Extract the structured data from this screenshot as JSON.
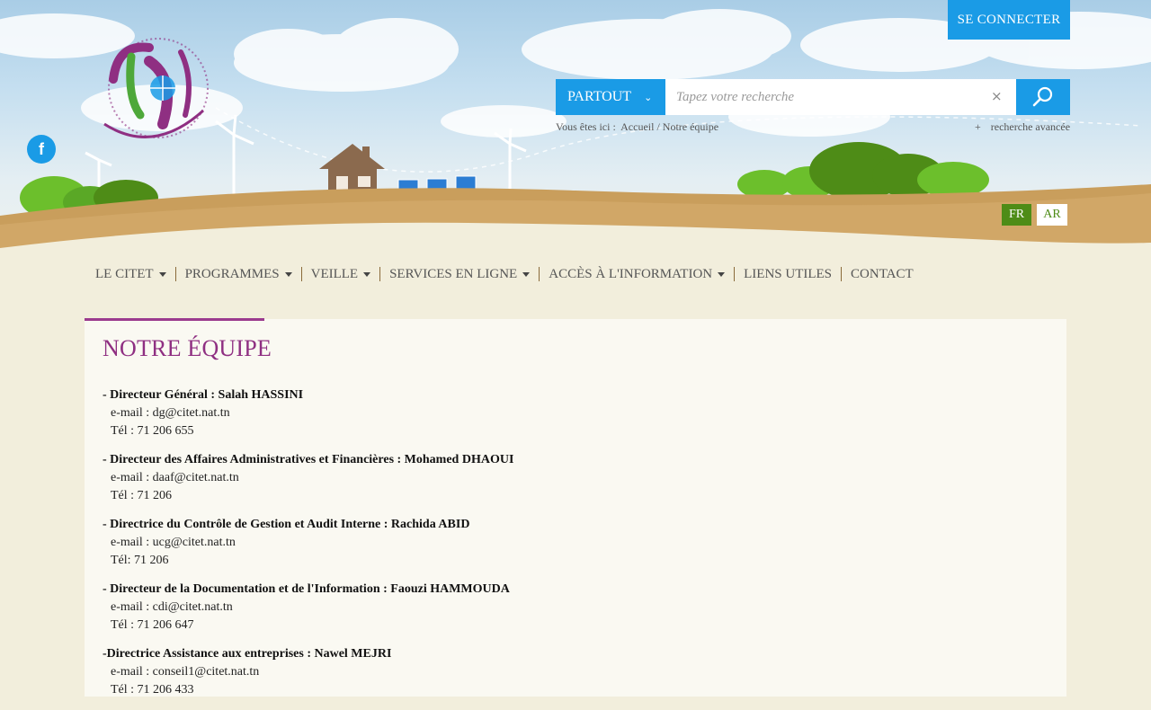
{
  "header": {
    "login_label": "SE CONNECTER",
    "facebook_icon": "f",
    "search": {
      "scope_label": "PARTOUT",
      "placeholder": "Tapez votre recherche",
      "clear_symbol": "×"
    },
    "breadcrumb": {
      "prefix": "Vous êtes ici :",
      "home": "Accueil",
      "separator": "/",
      "current": "Notre équipe"
    },
    "advanced_search": "recherche avancée",
    "advanced_plus": "+",
    "languages": [
      "FR",
      "AR"
    ],
    "colors": {
      "accent_blue": "#1a9be6",
      "green": "#4e8c17",
      "purple": "#8f2f82"
    }
  },
  "nav": {
    "items": [
      {
        "label": "LE CITET",
        "dropdown": true
      },
      {
        "label": "PROGRAMMES",
        "dropdown": true
      },
      {
        "label": "VEILLE",
        "dropdown": true
      },
      {
        "label": "SERVICES EN LIGNE",
        "dropdown": true
      },
      {
        "label": "ACCÈS À L'INFORMATION",
        "dropdown": true
      },
      {
        "label": "LIENS UTILES",
        "dropdown": false
      },
      {
        "label": "CONTACT",
        "dropdown": false
      }
    ]
  },
  "page": {
    "title": "NOTRE ÉQUIPE",
    "entries": [
      {
        "role": "- Directeur Général : Salah HASSINI",
        "email": "e-mail : dg@citet.nat.tn",
        "tel": "Tél : 71 206 655"
      },
      {
        "role": "- Directeur des Affaires Administratives et Financières : Mohamed DHAOUI",
        "email": "e-mail : daaf@citet.nat.tn",
        "tel": "Tél : 71 206"
      },
      {
        "role": "- Directrice du Contrôle de Gestion et Audit Interne : Rachida ABID",
        "email": "e-mail : ucg@citet.nat.tn",
        "tel": "Tél: 71 206"
      },
      {
        "role": "- Directeur de la Documentation et de l'Information : Faouzi HAMMOUDA",
        "email": "e-mail : cdi@citet.nat.tn",
        "tel": "Tél : 71 206 647"
      },
      {
        "role": "-Directrice Assistance aux entreprises : Nawel MEJRI",
        "email": "e-mail : conseil1@citet.nat.tn",
        "tel": "Tél : 71 206 433"
      }
    ]
  }
}
